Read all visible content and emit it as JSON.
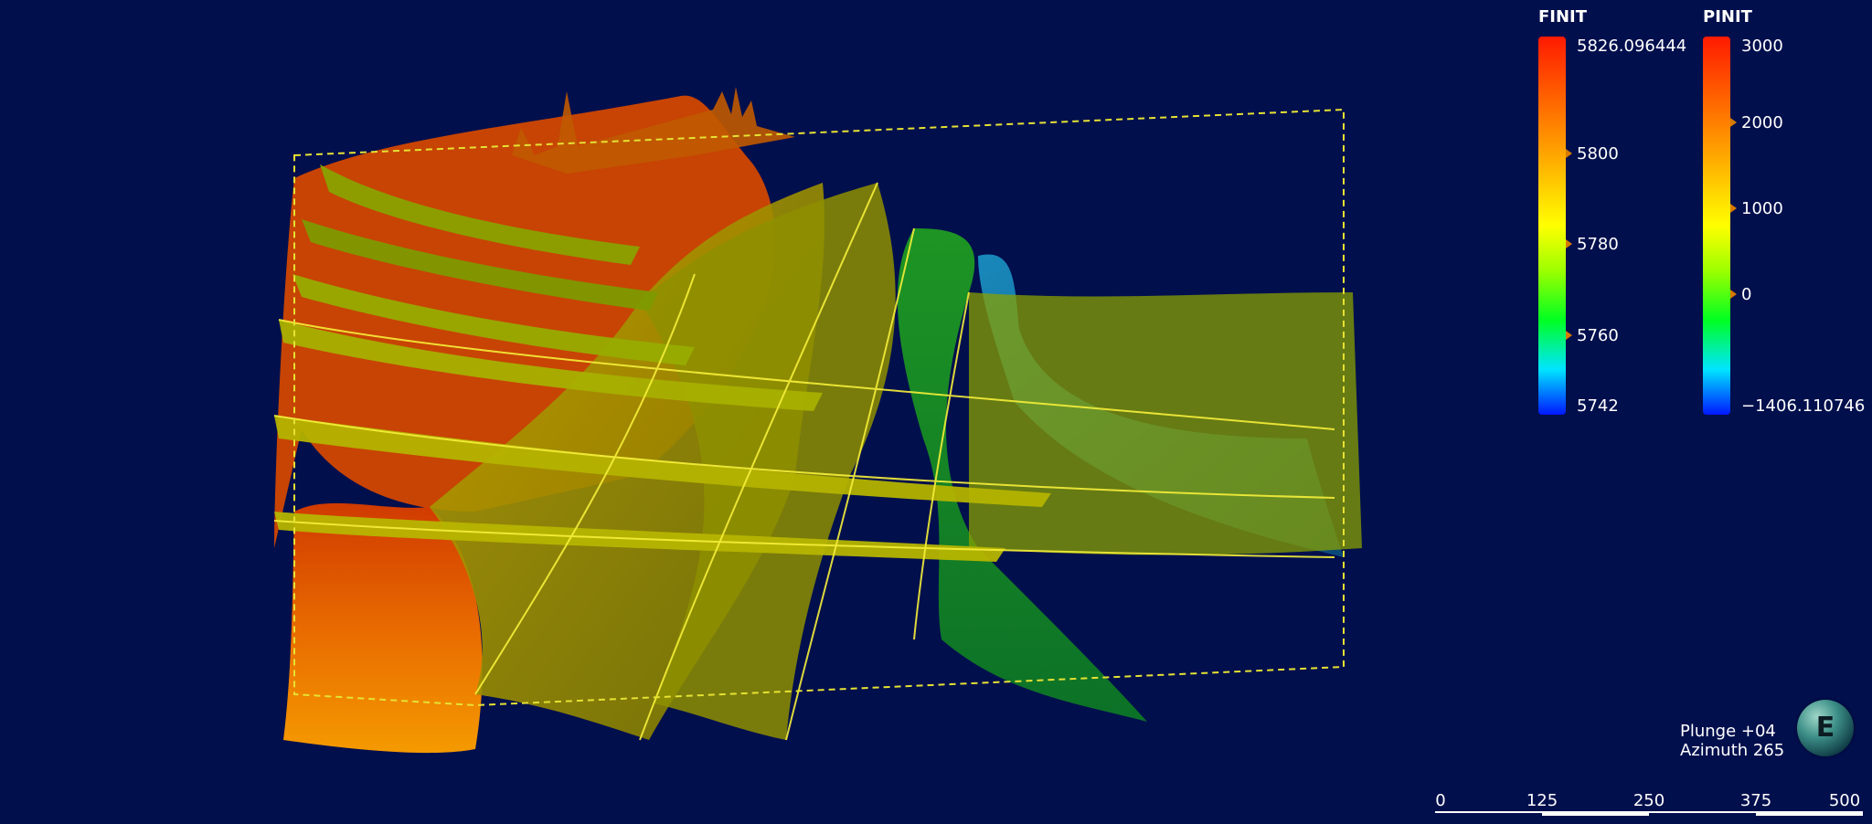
{
  "legends": [
    {
      "title": "FINIT",
      "ticks": [
        {
          "label": "5826.096444",
          "marker": false
        },
        {
          "label": "5800",
          "marker": true
        },
        {
          "label": "5780",
          "marker": true
        },
        {
          "label": "5760",
          "marker": true
        },
        {
          "label": "5742",
          "marker": false
        }
      ]
    },
    {
      "title": "PINIT",
      "ticks": [
        {
          "label": "3000",
          "marker": false
        },
        {
          "label": "2000",
          "marker": true
        },
        {
          "label": "1000",
          "marker": true
        },
        {
          "label": "0",
          "marker": true
        },
        {
          "label": "−1406.110746",
          "marker": false
        }
      ]
    }
  ],
  "orientation": {
    "plunge": "Plunge +04",
    "azimuth": "Azimuth 265"
  },
  "compass": {
    "letter": "E"
  },
  "scale_bar": {
    "labels": [
      "0",
      "125",
      "250",
      "375",
      "500"
    ]
  },
  "colors": {
    "background": "#020f4d",
    "bounding_box": "#e6e233"
  }
}
